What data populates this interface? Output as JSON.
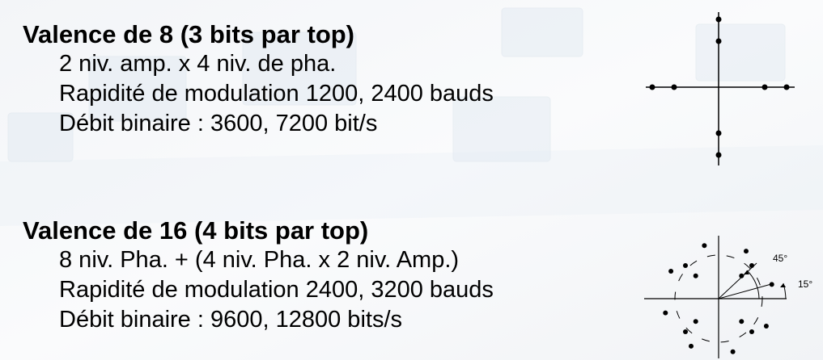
{
  "sections": [
    {
      "title": "Valence de 8 (3 bits par top)",
      "lines": [
        "2 niv. amp. x 4 niv. de pha.",
        "Rapidité de modulation 1200, 2400 bauds",
        "Débit binaire : 3600, 7200  bit/s"
      ]
    },
    {
      "title": "Valence de 16 (4 bits par top)",
      "lines": [
        "8 niv. Pha. + (4 niv. Pha. x 2 niv. Amp.)",
        "Rapidité de modulation 2400, 3200 bauds",
        "Débit binaire : 9600, 12800 bits/s"
      ]
    }
  ],
  "diagram16": {
    "angle_label_1": "45°",
    "angle_label_2": "15°"
  }
}
